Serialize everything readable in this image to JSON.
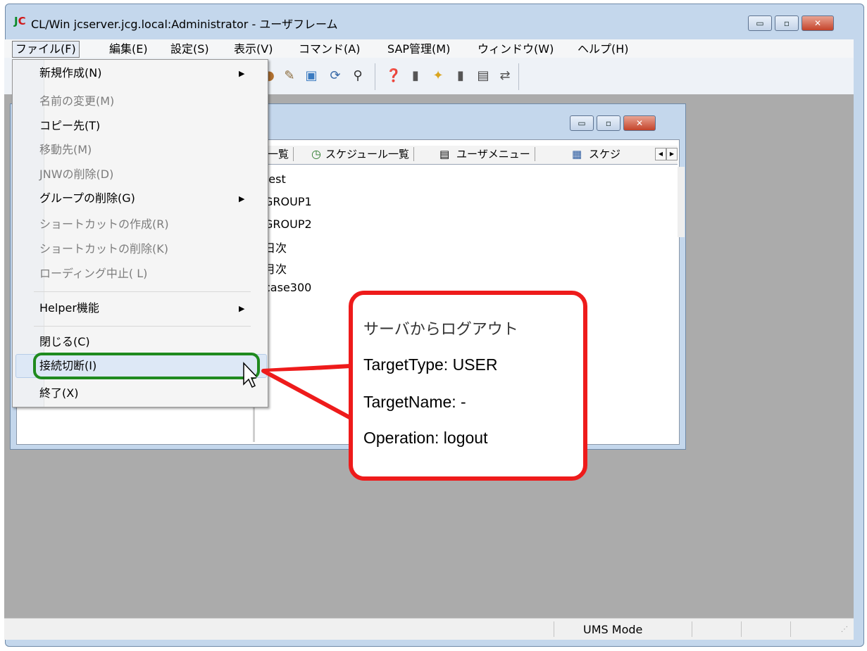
{
  "window": {
    "logo_j": "J",
    "logo_c": "C",
    "title": "CL/Win jcserver.jcg.local:Administrator - ユーザフレーム",
    "min_glyph": "▭",
    "max_glyph": "▫",
    "close_glyph": "✕"
  },
  "menubar": {
    "items": [
      "ファイル(F)",
      "編集(E)",
      "設定(S)",
      "表示(V)",
      "コマンド(A)",
      "SAP管理(M)",
      "ウィンドウ(W)",
      "ヘルプ(H)"
    ]
  },
  "child_window": {
    "min_glyph": "▭",
    "max_glyph": "▫",
    "close_glyph": "✕",
    "tabs": [
      "一覧",
      "スケジュール一覧",
      "ユーザメニュー",
      "スケジ"
    ],
    "tree": [
      "test",
      "GROUP1",
      "GROUP2",
      "日次",
      "月次",
      "case300"
    ]
  },
  "file_menu": {
    "items": [
      {
        "label": "新規作成(N)",
        "enabled": true,
        "submenu": true
      },
      {
        "label": "名前の変更(M)",
        "enabled": false
      },
      {
        "label": "コピー先(T)",
        "enabled": true
      },
      {
        "label": "移動先(M)",
        "enabled": false
      },
      {
        "label": "JNWの削除(D)",
        "enabled": false
      },
      {
        "label": "グループの削除(G)",
        "enabled": true,
        "submenu": true
      },
      {
        "label": "ショートカットの作成(R)",
        "enabled": false
      },
      {
        "label": "ショートカットの削除(K)",
        "enabled": false
      },
      {
        "label": "ローディング中止( L)",
        "enabled": false
      },
      {
        "label": "Helper機能",
        "enabled": true,
        "submenu": true
      },
      {
        "label": "閉じる(C)",
        "enabled": true
      },
      {
        "label": "接続切断(I)",
        "enabled": true,
        "highlighted": true
      },
      {
        "label": "終了(X)",
        "enabled": true
      }
    ],
    "submenu_arrow": "▶"
  },
  "callout": {
    "title": "サーバからログアウト",
    "line1": "TargetType: USER",
    "line2": "TargetName: -",
    "line3": "Operation: logout"
  },
  "statusbar": {
    "mode": "UMS Mode"
  },
  "colors": {
    "callout_border": "#ee1b1b",
    "highlight_box": "#1f8a1f",
    "mdi_background": "#ababab"
  }
}
